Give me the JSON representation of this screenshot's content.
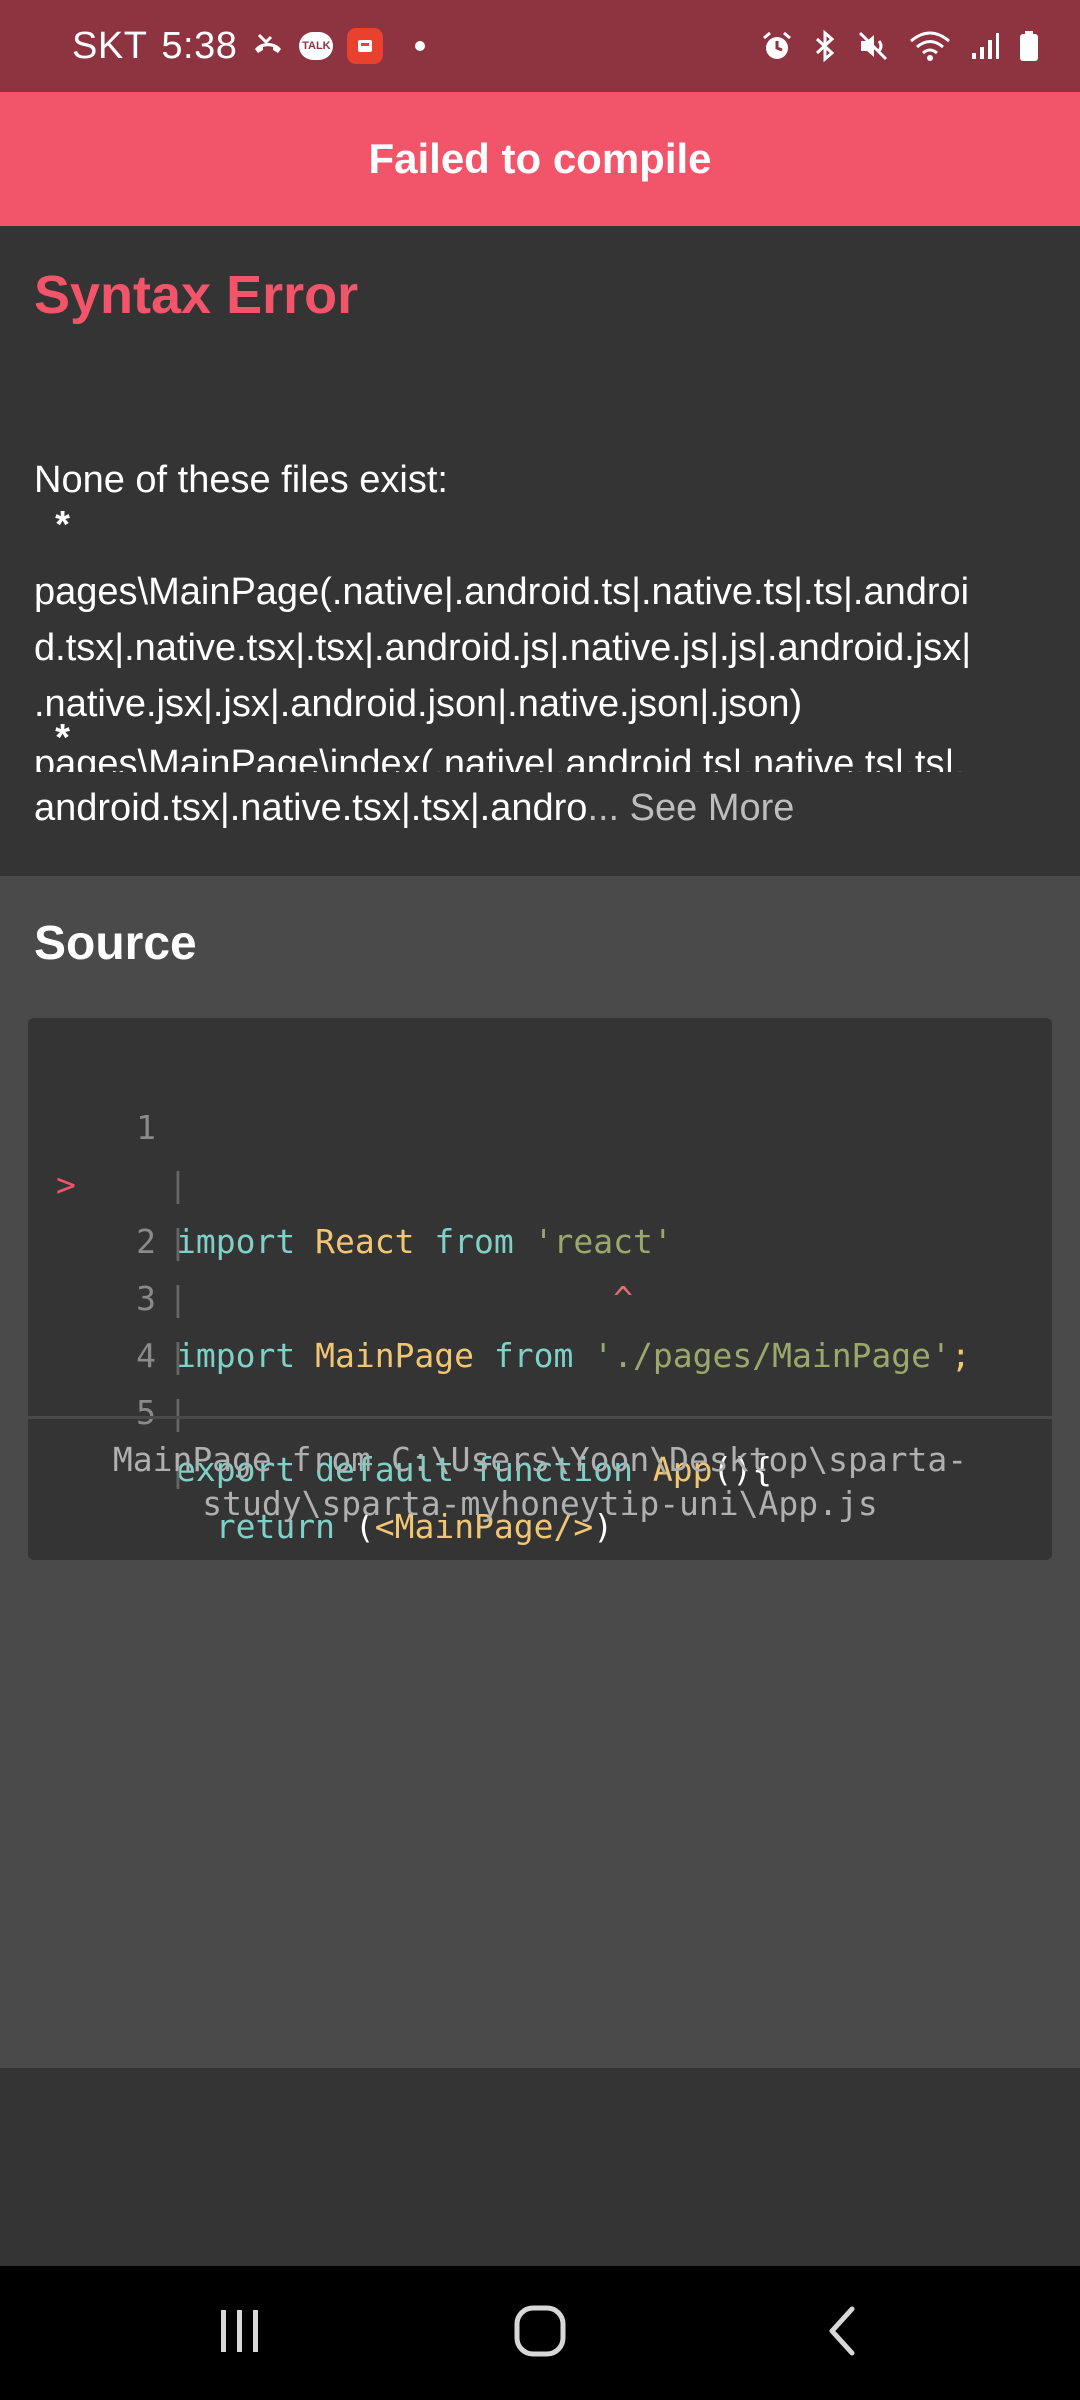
{
  "status_bar": {
    "carrier": "SKT",
    "time": "5:38",
    "left_icons": [
      "missed-call-icon",
      "talk-icon",
      "app-icon",
      "dot"
    ],
    "talk_label": "TALK",
    "right_icons": [
      "alarm-icon",
      "bluetooth-icon",
      "mute-icon",
      "wifi-icon",
      "signal-icon",
      "battery-icon"
    ]
  },
  "header": {
    "title": "Failed to compile"
  },
  "message": {
    "title": "Syntax Error",
    "lines": [
      "None of these files exist:",
      "  *",
      "pages\\MainPage(.native|.android.ts|.native.ts|.ts|.androi",
      "d.tsx|.native.tsx|.tsx|.android.js|.native.js|.js|.android.jsx|",
      ".native.jsx|.jsx|.android.json|.native.json|.json)",
      "  *",
      "pages\\MainPage\\index(.native|.android.ts|.native.ts|.ts|."
    ],
    "truncated_line": "android.tsx|.native.tsx|.tsx|.andro",
    "ellipsis": "...",
    "see_more": " See More"
  },
  "source": {
    "title": "Source",
    "code_lines": [
      {
        "num": "1",
        "marker": "",
        "text": "import React from 'react'"
      },
      {
        "num": "2",
        "marker": ">",
        "text": "import MainPage from './pages/MainPage';"
      },
      {
        "num": "",
        "marker": "",
        "text": "                      ^"
      },
      {
        "num": "3",
        "marker": "",
        "text": ""
      },
      {
        "num": "4",
        "marker": "",
        "text": "export default function App(){"
      },
      {
        "num": "5",
        "marker": "",
        "text": "  return (<MainPage/>)"
      }
    ],
    "footer_line1": "MainPage from C:\\Users\\Yoon\\Desktop\\sparta-",
    "footer_line2": "study\\sparta-myhoneytip-uni\\App.js"
  },
  "colors": {
    "status_bar": "#8e3340",
    "header": "#f2546a",
    "panel": "#343434",
    "background": "#4a4a4a"
  },
  "nav": {
    "buttons": [
      "recent-apps-icon",
      "home-icon",
      "back-icon"
    ]
  }
}
